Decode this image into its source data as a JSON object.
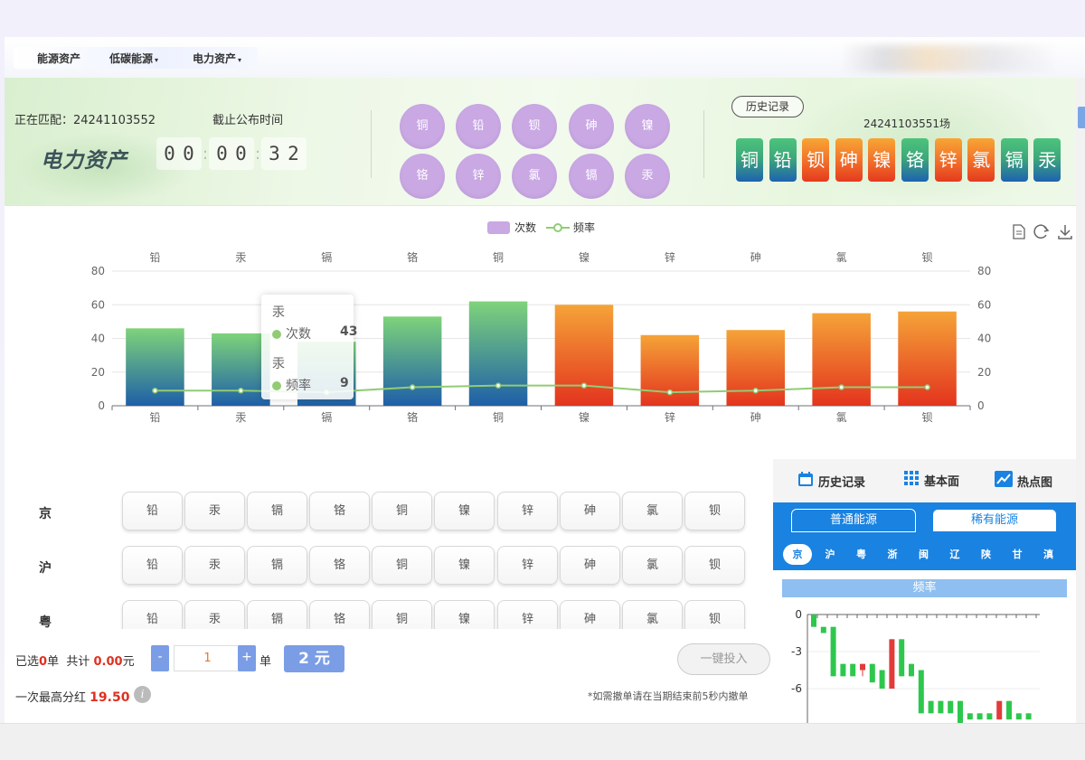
{
  "nav": {
    "items": [
      "能源资产",
      "低碳能源",
      "电力资产"
    ]
  },
  "header": {
    "matching_label": "正在匹配：24241103552",
    "cutoff_label": "截止公布时间",
    "brand": "电力资产",
    "timer": [
      "0",
      "0",
      "0",
      "0",
      "3",
      "2"
    ],
    "balls_row1": [
      "铜",
      "铅",
      "钡",
      "砷",
      "镍"
    ],
    "balls_row2": [
      "铬",
      "锌",
      "氯",
      "镉",
      "汞"
    ],
    "history_button": "历史记录",
    "round_no": "24241103551场",
    "results": [
      "铜",
      "铅",
      "钡",
      "砷",
      "镍",
      "铬",
      "锌",
      "氯",
      "镉",
      "汞"
    ],
    "result_colors": [
      "green",
      "green",
      "orange",
      "orange",
      "orange",
      "green",
      "orange",
      "orange",
      "green",
      "green"
    ]
  },
  "chart_data": {
    "type": "bar",
    "categories": [
      "铅",
      "汞",
      "镉",
      "铬",
      "铜",
      "镍",
      "锌",
      "砷",
      "氯",
      "钡"
    ],
    "series": [
      {
        "name": "次数",
        "type": "bar",
        "values": [
          46,
          43,
          38,
          53,
          62,
          60,
          42,
          45,
          55,
          56
        ]
      },
      {
        "name": "频率",
        "type": "line",
        "values": [
          9,
          9,
          8,
          11,
          12,
          12,
          8,
          9,
          11,
          11
        ]
      }
    ],
    "ylim": [
      0,
      80
    ],
    "yticks": [
      0,
      20,
      40,
      60,
      80
    ],
    "y2lim": [
      0,
      80
    ],
    "legend_position": "top",
    "bar_colors": [
      "green",
      "green",
      "green",
      "green",
      "green",
      "orange",
      "orange",
      "orange",
      "orange",
      "orange"
    ],
    "tooltip": {
      "category": "汞",
      "rows": [
        {
          "label": "次数",
          "value": 43
        },
        {
          "label": "频率",
          "value": 9
        }
      ]
    }
  },
  "board": {
    "rows": [
      "京",
      "沪",
      "粤"
    ],
    "options": [
      "铅",
      "汞",
      "镉",
      "铬",
      "铜",
      "镍",
      "锌",
      "砷",
      "氯",
      "钡"
    ]
  },
  "footer": {
    "selected_prefix": "已选",
    "selected_count": "0",
    "selected_unit": "单",
    "total_label": "共计",
    "total_value": "0.00",
    "total_unit": "元",
    "minus": "-",
    "plus": "+",
    "quantity": "1",
    "quantity_unit": "单",
    "price": "2 元",
    "invest_button": "一键投入",
    "max_label": "一次最高分红",
    "max_value": "19.50",
    "info": "i",
    "note": "*如需撤单请在当期结束前5秒内撤单"
  },
  "side": {
    "tabs": [
      "历史记录",
      "基本面",
      "热点图"
    ],
    "segments": [
      "普通能源",
      "稀有能源"
    ],
    "regions": [
      "京",
      "沪",
      "粤",
      "浙",
      "闽",
      "辽",
      "陕",
      "甘",
      "滇"
    ],
    "freq_title": "频率",
    "yticks": [
      "0",
      "-3",
      "-6"
    ],
    "candles": [
      {
        "o": 0,
        "c": -1,
        "h": 0,
        "l": -1
      },
      {
        "o": -1,
        "c": -1.5,
        "h": -1,
        "l": -1.5
      },
      {
        "o": -1,
        "c": -5,
        "h": -1,
        "l": -5
      },
      {
        "o": -4,
        "c": -5,
        "h": -4,
        "l": -5
      },
      {
        "o": -4,
        "c": -5,
        "h": -4,
        "l": -5
      },
      {
        "o": -4.5,
        "c": -4,
        "h": -4,
        "l": -5
      },
      {
        "o": -4,
        "c": -5.5,
        "h": -4,
        "l": -5.5
      },
      {
        "o": -4.5,
        "c": -6,
        "h": -4.5,
        "l": -6
      },
      {
        "o": -6,
        "c": -2,
        "h": -2,
        "l": -6
      },
      {
        "o": -2,
        "c": -5,
        "h": -2,
        "l": -5
      },
      {
        "o": -4,
        "c": -5,
        "h": -4,
        "l": -5
      },
      {
        "o": -4.5,
        "c": -8,
        "h": -4.5,
        "l": -8
      },
      {
        "o": -7,
        "c": -8,
        "h": -7,
        "l": -8
      },
      {
        "o": -7,
        "c": -8,
        "h": -7,
        "l": -8
      },
      {
        "o": -7,
        "c": -8,
        "h": -7,
        "l": -8
      },
      {
        "o": -7,
        "c": -9,
        "h": -7,
        "l": -9
      },
      {
        "o": -8,
        "c": -8.5,
        "h": -8,
        "l": -8.5
      },
      {
        "o": -8,
        "c": -8.5,
        "h": -8,
        "l": -8.5
      },
      {
        "o": -8,
        "c": -8.5,
        "h": -8,
        "l": -8.5
      },
      {
        "o": -8.5,
        "c": -7,
        "h": -7,
        "l": -8.5
      },
      {
        "o": -7,
        "c": -8.5,
        "h": -7,
        "l": -8.5
      },
      {
        "o": -8,
        "c": -8.5,
        "h": -8,
        "l": -8.5
      },
      {
        "o": -8,
        "c": -8.5,
        "h": -8,
        "l": -8.5
      }
    ]
  },
  "colors": {
    "accent": "#1a82e0",
    "ball": "#c9a8e4",
    "button": "#7b9de6",
    "bar_green_top": "#7ed37a",
    "bar_blue_bottom": "#1e5fa8",
    "bar_orange_top": "#f5a338",
    "bar_red_bottom": "#e3341e",
    "line": "#91cc75"
  }
}
